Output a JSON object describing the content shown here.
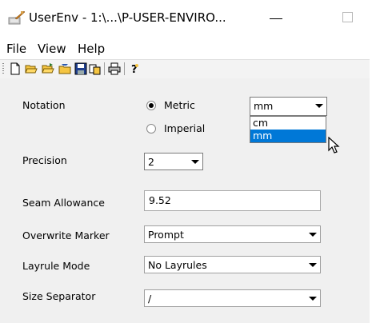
{
  "window": {
    "title": "UserEnv - 1:\\...\\P-USER-ENVIRO...",
    "app_icon": "userenv-app-icon",
    "minimize_icon": "minimize-icon",
    "maximize_icon": "maximize-icon"
  },
  "menu": {
    "items": [
      "File",
      "View",
      "Help"
    ]
  },
  "toolbar": {
    "icons": [
      "new-document-icon",
      "open-folder-icon",
      "open-folder-alt-icon",
      "close-folder-icon",
      "save-icon",
      "copy-icon",
      "print-icon",
      "help-icon"
    ]
  },
  "form": {
    "notation": {
      "label": "Notation",
      "options": [
        {
          "label": "Metric",
          "selected": true
        },
        {
          "label": "Imperial",
          "selected": false
        }
      ],
      "unit_value": "mm",
      "unit_options": [
        "cm",
        "mm"
      ],
      "unit_highlighted": "mm"
    },
    "precision": {
      "label": "Precision",
      "value": "2"
    },
    "seam_allowance": {
      "label": "Seam Allowance",
      "value": "9.52"
    },
    "overwrite_marker": {
      "label": "Overwrite Marker",
      "value": "Prompt"
    },
    "layrule_mode": {
      "label": "Layrule Mode",
      "value": "No Layrules"
    },
    "size_separator": {
      "label": "Size Separator",
      "value": "/"
    }
  },
  "colors": {
    "selection": "#0078d7",
    "panel": "#f0f0f0"
  }
}
